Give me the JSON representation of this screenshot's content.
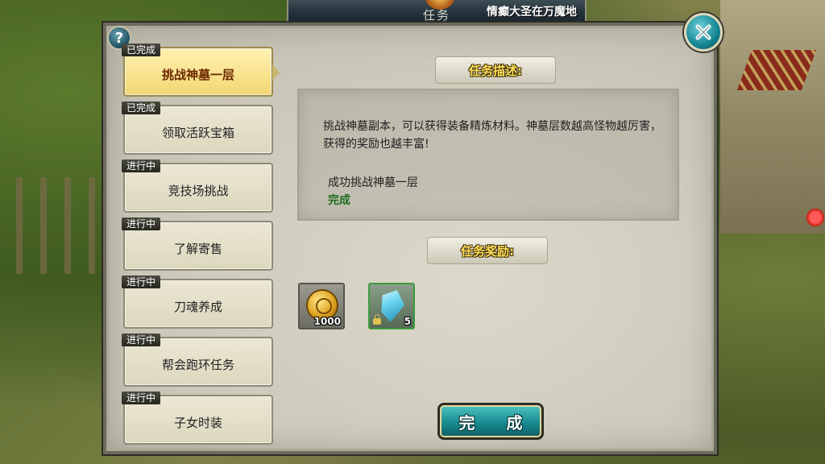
{
  "window": {
    "title": "任务",
    "notice": "情癫大圣在万魔地"
  },
  "tasks": [
    {
      "status": "已完成",
      "name": "挑战神墓一层",
      "selected": true
    },
    {
      "status": "已完成",
      "name": "领取活跃宝箱",
      "selected": false
    },
    {
      "status": "进行中",
      "name": "竞技场挑战",
      "selected": false
    },
    {
      "status": "进行中",
      "name": "了解寄售",
      "selected": false
    },
    {
      "status": "进行中",
      "name": "刀魂养成",
      "selected": false
    },
    {
      "status": "进行中",
      "name": "帮会跑环任务",
      "selected": false
    },
    {
      "status": "进行中",
      "name": "子女时装",
      "selected": false
    }
  ],
  "description": {
    "header": "任务描述:",
    "text": "挑战神墓副本，可以获得装备精炼材料。神墓层数越高怪物越厉害，获得的奖励也越丰富!",
    "goal": "成功挑战神墓一层",
    "goal_status": "完成"
  },
  "rewards": {
    "header": "任务奖励:",
    "items": [
      {
        "icon": "gold-coin-icon",
        "qty": "1000",
        "locked": false
      },
      {
        "icon": "blue-crystal-icon",
        "qty": "5",
        "locked": true
      }
    ]
  },
  "buttons": {
    "complete": "完 成",
    "help": "?",
    "close": "✕"
  },
  "colors": {
    "accent_teal": "#178a8f",
    "header_yellow": "#ffe15a",
    "completed_green": "#1d6b1d",
    "selected_task": "#f2d774"
  }
}
